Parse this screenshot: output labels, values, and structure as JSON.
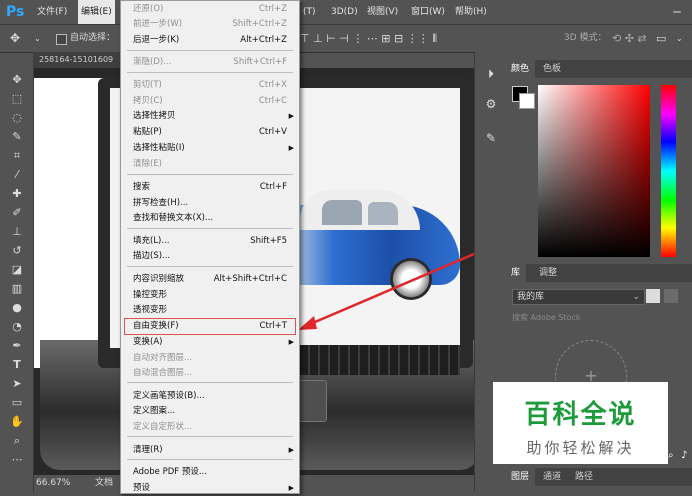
{
  "app": {
    "logo": "Ps",
    "minimize_glyph": "─"
  },
  "menubar": {
    "items": [
      "文件(F)",
      "编辑(E)",
      "(T)",
      "3D(D)",
      "视图(V)",
      "窗口(W)",
      "帮助(H)"
    ]
  },
  "optbar": {
    "auto_select_label": "自动选择：",
    "mode_3d_label": "3D 模式："
  },
  "document": {
    "tab_title": "258164-15101609",
    "zoom": "66.67%",
    "status_label": "文档"
  },
  "edit_menu": {
    "items": [
      {
        "label": "还原(O)",
        "shortcut": "Ctrl+Z",
        "disabled": true
      },
      {
        "label": "前进一步(W)",
        "shortcut": "Shift+Ctrl+Z",
        "disabled": true
      },
      {
        "label": "后退一步(K)",
        "shortcut": "Alt+Ctrl+Z",
        "disabled": false
      },
      {
        "label": "渐隐(D)...",
        "shortcut": "Shift+Ctrl+F",
        "disabled": true
      },
      {
        "label": "剪切(T)",
        "shortcut": "Ctrl+X",
        "disabled": true
      },
      {
        "label": "拷贝(C)",
        "shortcut": "Ctrl+C",
        "disabled": true
      },
      {
        "label": "选择性拷贝",
        "shortcut": "",
        "disabled": false,
        "submenu": true
      },
      {
        "label": "粘贴(P)",
        "shortcut": "Ctrl+V",
        "disabled": false
      },
      {
        "label": "选择性粘贴(I)",
        "shortcut": "",
        "disabled": false,
        "submenu": true
      },
      {
        "label": "清除(E)",
        "shortcut": "",
        "disabled": true
      },
      {
        "label": "搜索",
        "shortcut": "Ctrl+F",
        "disabled": false
      },
      {
        "label": "拼写检查(H)...",
        "shortcut": "",
        "disabled": false
      },
      {
        "label": "查找和替换文本(X)...",
        "shortcut": "",
        "disabled": false
      },
      {
        "label": "填充(L)...",
        "shortcut": "Shift+F5",
        "disabled": false
      },
      {
        "label": "描边(S)...",
        "shortcut": "",
        "disabled": false
      },
      {
        "label": "内容识别缩放",
        "shortcut": "Alt+Shift+Ctrl+C",
        "disabled": false
      },
      {
        "label": "操控变形",
        "shortcut": "",
        "disabled": false
      },
      {
        "label": "透视变形",
        "shortcut": "",
        "disabled": false
      },
      {
        "label": "自由变换(F)",
        "shortcut": "Ctrl+T",
        "disabled": false,
        "highlight": true
      },
      {
        "label": "变换(A)",
        "shortcut": "",
        "disabled": false,
        "submenu": true
      },
      {
        "label": "自动对齐图层...",
        "shortcut": "",
        "disabled": true
      },
      {
        "label": "自动混合图层...",
        "shortcut": "",
        "disabled": true
      },
      {
        "label": "定义画笔预设(B)...",
        "shortcut": "",
        "disabled": false
      },
      {
        "label": "定义图案...",
        "shortcut": "",
        "disabled": false
      },
      {
        "label": "定义自定形状...",
        "shortcut": "",
        "disabled": true
      },
      {
        "label": "清理(R)",
        "shortcut": "",
        "disabled": false,
        "submenu": true
      },
      {
        "label": "Adobe PDF 预设...",
        "shortcut": "",
        "disabled": false
      },
      {
        "label": "预设",
        "shortcut": "",
        "disabled": false,
        "submenu": true
      }
    ],
    "submenu_glyph": "▶"
  },
  "color_panel": {
    "tab_active": "颜色",
    "tab_other": "色板"
  },
  "library_panel": {
    "tab_active": "库",
    "tab_other": "调整",
    "select_value": "我的库",
    "search_placeholder": "搜索 Adobe Stock",
    "drop_glyph": "+"
  },
  "layers_panel": {
    "tabs": [
      "图层",
      "通道",
      "路径"
    ]
  },
  "watermark": {
    "title": "百科全说",
    "subtitle": "助你轻松解决"
  },
  "colors": {
    "accent_red": "#e0252b",
    "brand_blue": "#31a8ff",
    "watermark_green": "#1d9b3a"
  }
}
